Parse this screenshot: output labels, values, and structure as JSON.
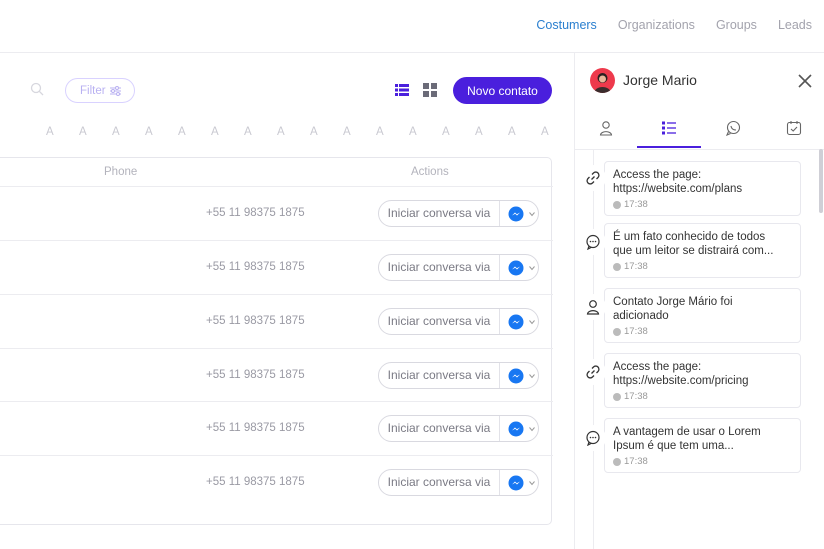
{
  "nav": {
    "items": [
      {
        "label": "Costumers",
        "active": true
      },
      {
        "label": "Organizations",
        "active": false
      },
      {
        "label": "Groups",
        "active": false
      },
      {
        "label": "Leads",
        "active": false
      }
    ]
  },
  "toolbar": {
    "filter_label": "Filter",
    "new_contact_label": "Novo contato"
  },
  "alphabet": [
    "A",
    "A",
    "A",
    "A",
    "A",
    "A",
    "A",
    "A",
    "A",
    "A",
    "A",
    "A",
    "A",
    "A",
    "A",
    "A"
  ],
  "table": {
    "columns": {
      "phone": "Phone",
      "actions": "Actions"
    },
    "rows": [
      {
        "phone": "+55 11 98375 1875",
        "action": "Iniciar conversa via"
      },
      {
        "phone": "+55 11 98375 1875",
        "action": "Iniciar conversa via"
      },
      {
        "phone": "+55 11 98375 1875",
        "action": "Iniciar conversa via"
      },
      {
        "phone": "+55 11 98375 1875",
        "action": "Iniciar conversa via"
      },
      {
        "phone": "+55 11 98375 1875",
        "action": "Iniciar conversa via"
      },
      {
        "phone": "+55 11 98375 1875",
        "action": "Iniciar conversa via"
      }
    ]
  },
  "panel": {
    "contact_name": "Jorge Mario",
    "tabs": [
      "profile",
      "activity",
      "chat",
      "tasks"
    ],
    "active_tab": "activity",
    "timeline": [
      {
        "icon": "link-icon",
        "line1": "Access the page:",
        "line2": "https://website.com/plans",
        "time": "17:38"
      },
      {
        "icon": "chat-icon",
        "line1": "É um fato conhecido de todos",
        "line2": "que um leitor se distrairá com...",
        "time": "17:38"
      },
      {
        "icon": "user-icon",
        "line1": "Contato Jorge Mário foi",
        "line2": "adicionado",
        "time": "17:38"
      },
      {
        "icon": "link-icon",
        "line1": "Access the page:",
        "line2": "https://website.com/pricing",
        "time": "17:38"
      },
      {
        "icon": "chat-icon",
        "line1": "A vantagem de usar o Lorem",
        "line2": "Ipsum é que tem uma...",
        "time": "17:38"
      }
    ]
  },
  "colors": {
    "accent": "#4a1fdd",
    "nav_active": "#2a7fcf",
    "messenger": "#1877f2"
  }
}
